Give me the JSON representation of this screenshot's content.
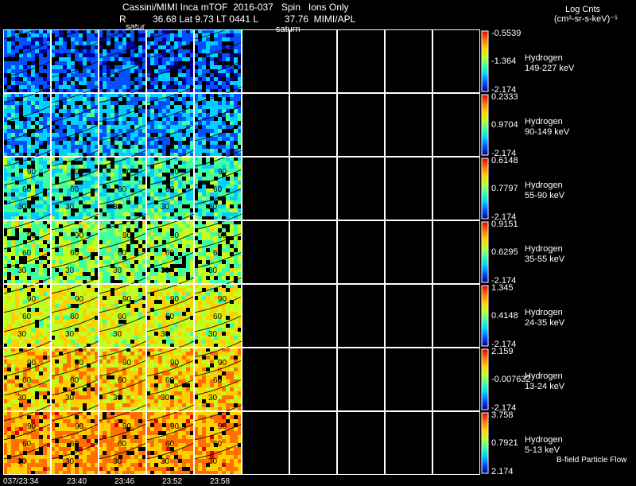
{
  "header": {
    "title": "Cassini/MIMI Inca mTOF  2016-037   Spin   Ions Only",
    "position_line": "R          36.68 Lat 9.73 LT 0441 L          37.76  MIMI/APL",
    "saturn_label_1": "satur",
    "saturn_label_2": "saturn",
    "units_title": "Log Cnts",
    "units": "(cm²-sr-s-keV)⁻¹"
  },
  "footer": {
    "bfield_label": "B-field Particle Flow"
  },
  "chart_data": {
    "type": "heatmap",
    "title": "Cassini/MIMI Inca mTOF  2016-037   Spin   Ions Only",
    "x_tick_labels": [
      "037/23:34",
      "23:40",
      "23:46",
      "23:52",
      "23:58"
    ],
    "columns_total": 10,
    "columns_filled": 5,
    "contour_labels": [
      "90",
      "60",
      "30"
    ],
    "colorbar_colors": [
      "#ffffff",
      "#0000a0",
      "#0050ff",
      "#00d0ff",
      "#40ffa0",
      "#c0ff20",
      "#ffd000",
      "#ff7000",
      "#e00000"
    ],
    "panels": [
      {
        "species": "Hydrogen",
        "energy": "149-227 keV",
        "cmax": "-0.5539",
        "cmid": "-1.364",
        "cmin": "-2.174",
        "level": 0.15
      },
      {
        "species": "Hydrogen",
        "energy": "90-149 keV",
        "cmax": "0.2333",
        "cmid": "0.9704",
        "cmin": "-2.174",
        "level": 0.25
      },
      {
        "species": "Hydrogen",
        "energy": "55-90 keV",
        "cmax": "0.6148",
        "cmid": "0.7797",
        "cmin": "-2.174",
        "level": 0.4
      },
      {
        "species": "Hydrogen",
        "energy": "35-55 keV",
        "cmax": "0.9151",
        "cmid": "0.6295",
        "cmin": "-2.174",
        "level": 0.52
      },
      {
        "species": "Hydrogen",
        "energy": "24-35 keV",
        "cmax": "1.345",
        "cmid": "0.4148",
        "cmin": "-2.174",
        "level": 0.62
      },
      {
        "species": "Hydrogen",
        "energy": "13-24 keV",
        "cmax": "2.159",
        "cmid": "-0.007632",
        "cmin": "-2.174",
        "level": 0.72
      },
      {
        "species": "Hydrogen",
        "energy": "5-13 keV",
        "cmax": "3.758",
        "cmid": "0.7921",
        "cmin": "2.174",
        "level": 0.8
      }
    ]
  }
}
